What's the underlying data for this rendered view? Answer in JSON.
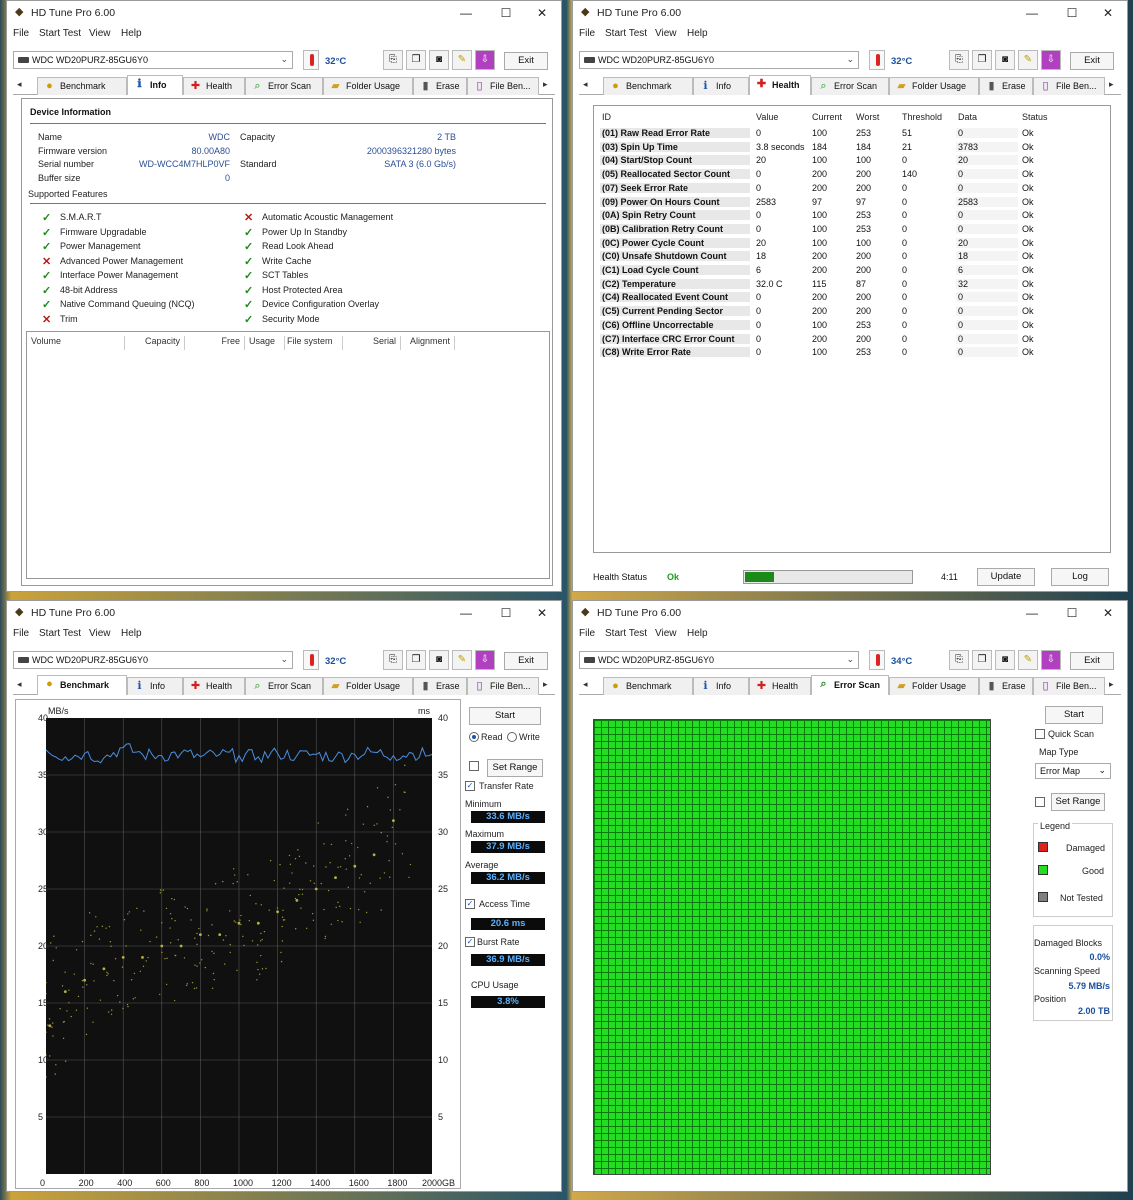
{
  "app": {
    "title": "HD Tune Pro 6.00",
    "menu": [
      "File",
      "Start Test",
      "View",
      "Help"
    ],
    "exit": "Exit",
    "drive": "WDC WD20PURZ-85GU6Y0"
  },
  "tabs": [
    "Benchmark",
    "Info",
    "Health",
    "Error Scan",
    "Folder Usage",
    "Erase",
    "File Ben..."
  ],
  "colors": {
    "good": "#22dd22",
    "damaged": "#dd2222",
    "not_tested": "#808080",
    "accent": "#1a4fa0"
  },
  "info": {
    "temperature": "32°C",
    "section_title": "Device Information",
    "name_label": "Name",
    "name": "WDC",
    "fw_label": "Firmware version",
    "fw": "80.00A80",
    "serial_label": "Serial number",
    "serial": "WD-WCC4M7HLP0VF",
    "buffer_label": "Buffer size",
    "buffer": "0",
    "capacity_label": "Capacity",
    "capacity": "2 TB",
    "capacity_bytes": "2000396321280 bytes",
    "standard_label": "Standard",
    "standard": "SATA 3 (6.0 Gb/s)",
    "features_title": "Supported Features",
    "features_left": [
      {
        "name": "S.M.A.R.T",
        "ok": true
      },
      {
        "name": "Firmware Upgradable",
        "ok": true
      },
      {
        "name": "Power Management",
        "ok": true
      },
      {
        "name": "Advanced Power Management",
        "ok": false
      },
      {
        "name": "Interface Power Management",
        "ok": true
      },
      {
        "name": "48-bit Address",
        "ok": true
      },
      {
        "name": "Native Command Queuing (NCQ)",
        "ok": true
      },
      {
        "name": "Trim",
        "ok": false
      }
    ],
    "features_right": [
      {
        "name": "Automatic Acoustic Management",
        "ok": false
      },
      {
        "name": "Power Up In Standby",
        "ok": true
      },
      {
        "name": "Read Look Ahead",
        "ok": true
      },
      {
        "name": "Write Cache",
        "ok": true
      },
      {
        "name": "SCT Tables",
        "ok": true
      },
      {
        "name": "Host Protected Area",
        "ok": true
      },
      {
        "name": "Device Configuration Overlay",
        "ok": true
      },
      {
        "name": "Security Mode",
        "ok": true
      }
    ],
    "volume_headers": [
      "Volume",
      "Capacity",
      "Free",
      "Usage",
      "File system",
      "Serial",
      "Alignment"
    ]
  },
  "health": {
    "temperature": "32°C",
    "headers": [
      "ID",
      "Value",
      "Current",
      "Worst",
      "Threshold",
      "Data",
      "Status"
    ],
    "rows": [
      [
        "(01) Raw Read Error Rate",
        "0",
        "100",
        "253",
        "51",
        "0",
        "Ok"
      ],
      [
        "(03) Spin Up Time",
        "3.8 seconds",
        "184",
        "184",
        "21",
        "3783",
        "Ok"
      ],
      [
        "(04) Start/Stop Count",
        "20",
        "100",
        "100",
        "0",
        "20",
        "Ok"
      ],
      [
        "(05) Reallocated Sector Count",
        "0",
        "200",
        "200",
        "140",
        "0",
        "Ok"
      ],
      [
        "(07) Seek Error Rate",
        "0",
        "200",
        "200",
        "0",
        "0",
        "Ok"
      ],
      [
        "(09) Power On Hours Count",
        "2583",
        "97",
        "97",
        "0",
        "2583",
        "Ok"
      ],
      [
        "(0A) Spin Retry Count",
        "0",
        "100",
        "253",
        "0",
        "0",
        "Ok"
      ],
      [
        "(0B) Calibration Retry Count",
        "0",
        "100",
        "253",
        "0",
        "0",
        "Ok"
      ],
      [
        "(0C) Power Cycle Count",
        "20",
        "100",
        "100",
        "0",
        "20",
        "Ok"
      ],
      [
        "(C0) Unsafe Shutdown Count",
        "18",
        "200",
        "200",
        "0",
        "18",
        "Ok"
      ],
      [
        "(C1) Load Cycle Count",
        "6",
        "200",
        "200",
        "0",
        "6",
        "Ok"
      ],
      [
        "(C2) Temperature",
        "32.0 C",
        "115",
        "87",
        "0",
        "32",
        "Ok"
      ],
      [
        "(C4) Reallocated Event Count",
        "0",
        "200",
        "200",
        "0",
        "0",
        "Ok"
      ],
      [
        "(C5) Current Pending Sector",
        "0",
        "200",
        "200",
        "0",
        "0",
        "Ok"
      ],
      [
        "(C6) Offline Uncorrectable",
        "0",
        "100",
        "253",
        "0",
        "0",
        "Ok"
      ],
      [
        "(C7) Interface CRC Error Count",
        "0",
        "200",
        "200",
        "0",
        "0",
        "Ok"
      ],
      [
        "(C8) Write Error Rate",
        "0",
        "100",
        "253",
        "0",
        "0",
        "Ok"
      ]
    ],
    "status_label": "Health Status",
    "status": "Ok",
    "progress": 0.17,
    "time": "4:11",
    "update": "Update",
    "log": "Log"
  },
  "benchmark": {
    "temperature": "32°C",
    "start": "Start",
    "read": "Read",
    "write": "Write",
    "set_range": "Set Range",
    "transfer_rate": "Transfer Rate",
    "minimum_label": "Minimum",
    "minimum": "33.6 MB/s",
    "maximum_label": "Maximum",
    "maximum": "37.9 MB/s",
    "average_label": "Average",
    "average": "36.2 MB/s",
    "access_label": "Access Time",
    "access": "20.6 ms",
    "burst_label": "Burst Rate",
    "burst": "36.9 MB/s",
    "cpu_label": "CPU Usage",
    "cpu": "3.8%",
    "y_unit_left": "MB/s",
    "y_unit_right": "ms",
    "y_ticks": [
      "40",
      "35",
      "30",
      "25",
      "20",
      "15",
      "10",
      "5"
    ],
    "x_ticks": [
      "0",
      "200",
      "400",
      "600",
      "800",
      "1000",
      "1200",
      "1400",
      "1600",
      "1800",
      "2000GB"
    ]
  },
  "chart_data": {
    "type": "line",
    "x_unit": "GB",
    "xlim": [
      0,
      2000
    ],
    "ylim": [
      0,
      40
    ],
    "series": [
      {
        "name": "Transfer Rate",
        "unit": "MB/s",
        "x": [
          0,
          100,
          200,
          300,
          400,
          500,
          600,
          700,
          800,
          900,
          1000,
          1100,
          1200,
          1300,
          1400,
          1500,
          1600,
          1700,
          1800,
          1900,
          2000
        ],
        "values": [
          37.2,
          36.6,
          36.9,
          36.5,
          37.4,
          36.8,
          36.7,
          36.9,
          36.6,
          36.8,
          36.7,
          36.6,
          36.9,
          36.7,
          36.8,
          36.6,
          36.8,
          37.0,
          36.7,
          36.9,
          36.8
        ]
      },
      {
        "name": "Access Time",
        "unit": "ms",
        "type": "scatter",
        "x": [
          20,
          100,
          200,
          300,
          400,
          500,
          600,
          700,
          800,
          900,
          1000,
          1100,
          1200,
          1300,
          1400,
          1500,
          1600,
          1700,
          1800
        ],
        "values": [
          13,
          16,
          17,
          18,
          19,
          19,
          20,
          20,
          21,
          21,
          22,
          22,
          23,
          24,
          25,
          26,
          27,
          28,
          31
        ]
      }
    ],
    "grid": true
  },
  "errorscan": {
    "temperature": "34°C",
    "start": "Start",
    "quick_scan": "Quick Scan",
    "map_type_label": "Map Type",
    "map_type": "Error Map",
    "set_range": "Set Range",
    "legend_title": "Legend",
    "damaged": "Damaged",
    "good": "Good",
    "not_tested": "Not Tested",
    "damaged_blocks_label": "Damaged Blocks",
    "damaged_blocks": "0.0%",
    "speed_label": "Scanning Speed",
    "speed": "5.79 MB/s",
    "position_label": "Position",
    "position": "2.00 TB"
  }
}
